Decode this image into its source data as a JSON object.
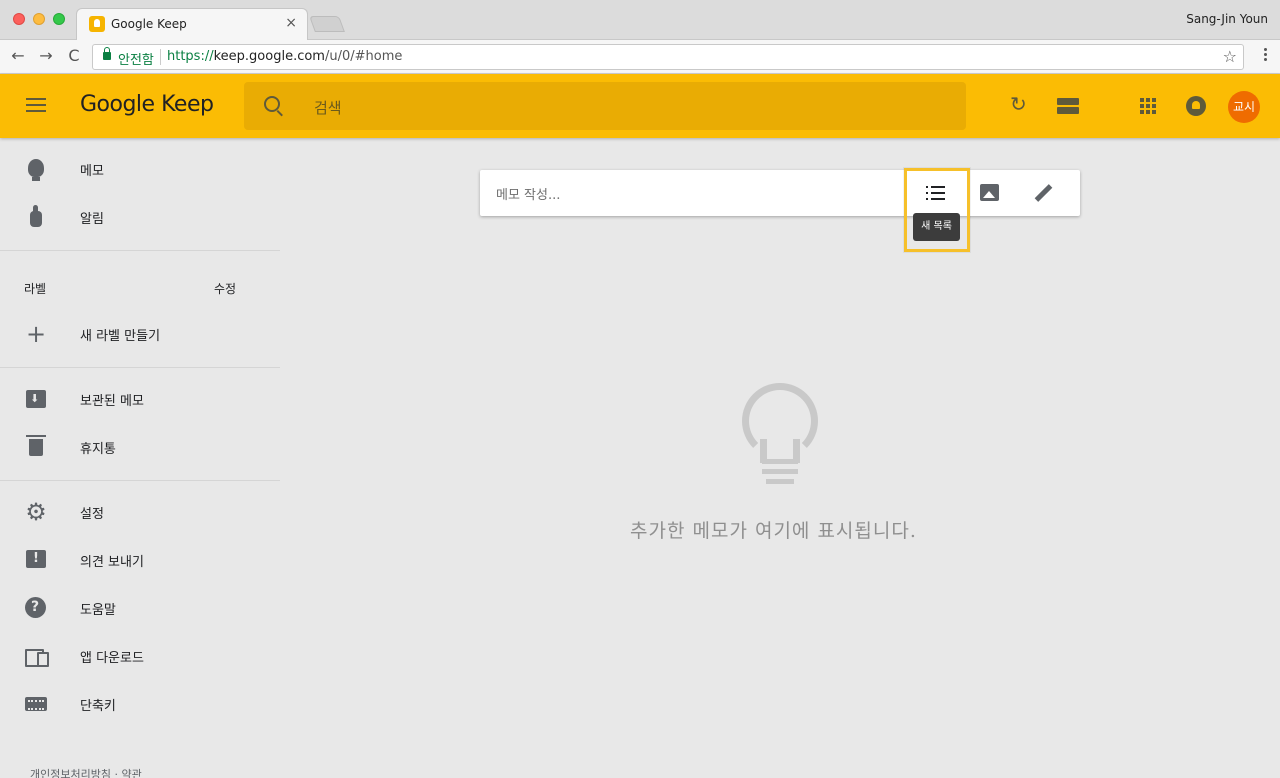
{
  "browser": {
    "tab_title": "Google Keep",
    "tab_close": "×",
    "profile_name": "Sang-Jin Youn",
    "secure_label": "안전함",
    "url_scheme": "https://",
    "url_host": "keep.google.com",
    "url_path": "/u/0/#home",
    "back": "←",
    "forward": "→",
    "reload": "C",
    "star": "☆"
  },
  "header": {
    "logo": "Google Keep",
    "search_placeholder": "검색",
    "refresh": "↻",
    "avatar_text": "교시",
    "accent_color": "#fbbc04"
  },
  "sidebar": {
    "items_top": [
      {
        "label": "메모",
        "icon": "bulb-icon"
      },
      {
        "label": "알림",
        "icon": "reminder-icon"
      }
    ],
    "labels_heading": "라벨",
    "labels_edit": "수정",
    "new_label": "새 라벨 만들기",
    "new_label_icon": "+",
    "items_mid": [
      {
        "label": "보관된 메모",
        "icon": "archive-icon"
      },
      {
        "label": "휴지통",
        "icon": "trash-icon"
      }
    ],
    "items_bottom": [
      {
        "label": "설정",
        "icon": "settings-icon",
        "glyph": "⚙"
      },
      {
        "label": "의견 보내기",
        "icon": "feedback-icon"
      },
      {
        "label": "도움말",
        "icon": "help-icon"
      },
      {
        "label": "앱 다운로드",
        "icon": "devices-icon"
      },
      {
        "label": "단축키",
        "icon": "keyboard-icon"
      }
    ],
    "footer": "개인정보처리방침 · 약관"
  },
  "main": {
    "composer_placeholder": "메모 작성...",
    "tooltip": "새 목록",
    "empty_message": "추가한 메모가 여기에 표시됩니다."
  }
}
